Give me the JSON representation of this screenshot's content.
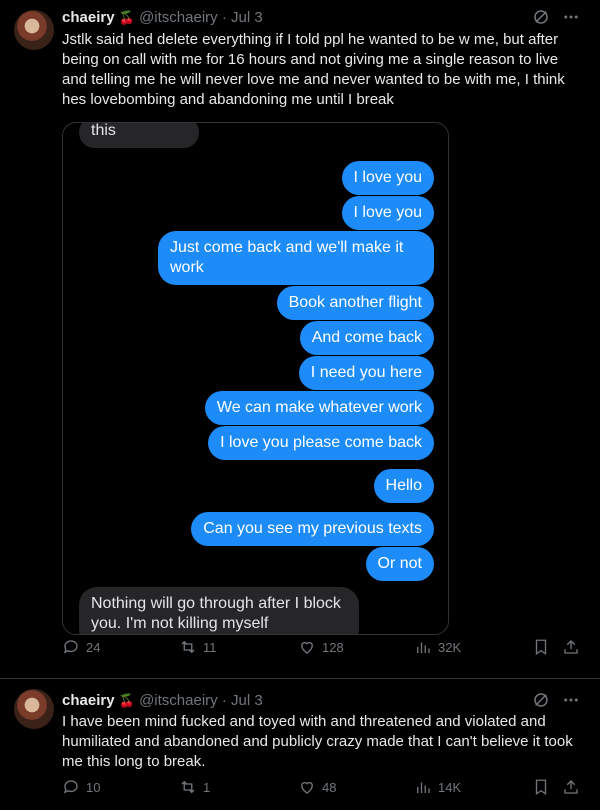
{
  "tweets": [
    {
      "author": "chaeiry",
      "badge_icon": "cherries-icon",
      "handle": "@itschaeiry",
      "dot": "·",
      "date": "Jul 3",
      "text": "Jstlk said hed delete everything if I told ppl he wanted to be w me, but after being on call with me for 16 hours and not giving me a single reason to live and telling me he will never love me and never wanted to be with me, I think hes lovebombing and abandoning me until I break",
      "media": {
        "messages": [
          {
            "dir": "in",
            "text": "this"
          },
          {
            "dir": "out",
            "text": "I love you"
          },
          {
            "dir": "out",
            "text": "I love you"
          },
          {
            "dir": "out",
            "text": "Just come back and we'll make it work"
          },
          {
            "dir": "out",
            "text": "Book another flight"
          },
          {
            "dir": "out",
            "text": "And come back"
          },
          {
            "dir": "out",
            "text": "I need you here"
          },
          {
            "dir": "out",
            "text": "We can make whatever work"
          },
          {
            "dir": "out",
            "text": "I love you please come back"
          },
          {
            "dir": "out",
            "text": "Hello"
          },
          {
            "dir": "out",
            "text": "Can you see my previous texts"
          },
          {
            "dir": "out",
            "text": "Or not"
          },
          {
            "dir": "in",
            "text": "Nothing will go through after I block you. I'm not killing myself"
          }
        ]
      },
      "stats": {
        "replies": "24",
        "reposts": "11",
        "likes": "128",
        "views": "32K"
      }
    },
    {
      "author": "chaeiry",
      "badge_icon": "cherries-icon",
      "handle": "@itschaeiry",
      "dot": "·",
      "date": "Jul 3",
      "text": "I have been mind fucked and toyed with and threatened and violated and humiliated and abandoned and publicly crazy made that I can't believe it took me this long to break.",
      "stats": {
        "replies": "10",
        "reposts": "1",
        "likes": "48",
        "views": "14K"
      }
    }
  ],
  "colors": {
    "background": "#000000",
    "text": "#e7e9ea",
    "muted": "#71767b",
    "imessage_blue": "#1d8cf8",
    "imessage_gray": "#262628",
    "divider": "#2f3336"
  }
}
